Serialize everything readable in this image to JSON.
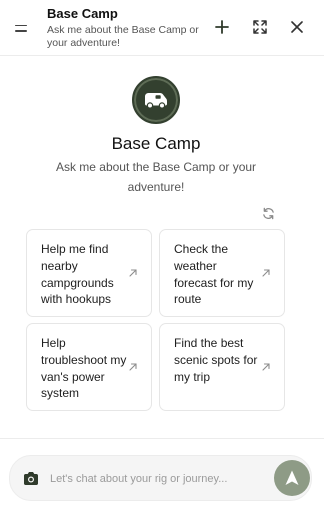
{
  "header": {
    "title": "Base Camp",
    "subtitle": "Ask me about the Base Camp or your adventure!",
    "menu_icon": "menu-icon",
    "new_chat_icon": "plus-icon",
    "expand_icon": "expand-icon",
    "close_icon": "close-icon"
  },
  "hero": {
    "avatar_icon": "van-icon",
    "title": "Base Camp",
    "subtitle": "Ask me about the Base Camp or your adventure!",
    "refresh_icon": "refresh-icon"
  },
  "suggestions": [
    {
      "text": "Help me find nearby campgrounds with hookups",
      "icon": "arrow-up-right-icon"
    },
    {
      "text": "Check the weather forecast for my route",
      "icon": "arrow-up-right-icon"
    },
    {
      "text": "Help troubleshoot my van's power system",
      "icon": "arrow-up-right-icon"
    },
    {
      "text": "Find the best scenic spots for my trip",
      "icon": "arrow-up-right-icon"
    }
  ],
  "composer": {
    "placeholder": "Let's chat about your rig or journey...",
    "value": "",
    "camera_icon": "camera-icon",
    "send_icon": "send-icon"
  },
  "colors": {
    "brand": "#33402f",
    "send_button": "#8e9b86",
    "text": "#1e1e1e",
    "muted": "#555555"
  }
}
